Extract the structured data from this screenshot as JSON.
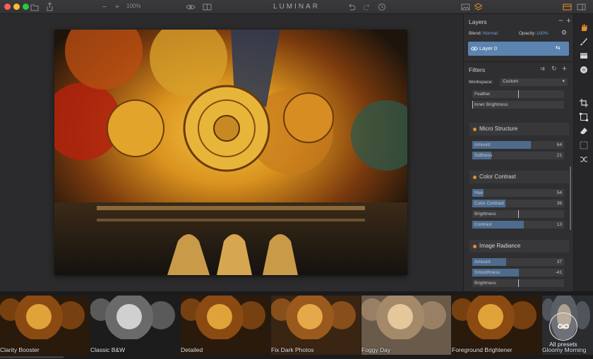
{
  "app": {
    "title": "LUMINAR",
    "zoom": "100%"
  },
  "colors": {
    "accent": "#5b84b0",
    "orange": "#e48d2a",
    "link": "#6fa3d9"
  },
  "layers": {
    "title": "Layers",
    "blend_label": "Blend:",
    "blend_value": "Normal",
    "opacity_label": "Opacity:",
    "opacity_value": "100%",
    "layer_name": "Layer 0"
  },
  "filters": {
    "title": "Filters",
    "workspace_label": "Workspace:",
    "workspace_value": "Custom",
    "top_sliders": [
      {
        "label": "Feather",
        "value": "",
        "level": 0.5
      },
      {
        "label": "Inner Brightness",
        "value": "",
        "level": 0.0
      }
    ],
    "groups": [
      {
        "name": "Micro Structure",
        "sliders": [
          {
            "label": "Amount",
            "value": "64",
            "level": 0.64
          },
          {
            "label": "Softness",
            "value": "21",
            "level": 0.21
          }
        ]
      },
      {
        "name": "Color Contrast",
        "sliders": [
          {
            "label": "Hue",
            "value": "54",
            "level": 0.12
          },
          {
            "label": "Color Contrast",
            "value": "36",
            "level": 0.36
          },
          {
            "label": "Brightness",
            "value": "",
            "level": 0.5
          },
          {
            "label": "Contrast",
            "value": "13",
            "level": 0.56
          }
        ]
      },
      {
        "name": "Image Radiance",
        "sliders": [
          {
            "label": "Amount",
            "value": "37",
            "level": 0.37
          },
          {
            "label": "Smoothness",
            "value": "-41",
            "level": 0.51
          },
          {
            "label": "Brightness",
            "value": "",
            "level": 0.5
          }
        ]
      }
    ]
  },
  "presets": [
    {
      "label": "Clarity Booster",
      "tone": "warm"
    },
    {
      "label": "Classic B&W",
      "tone": "bw"
    },
    {
      "label": "Detailed",
      "tone": "warm"
    },
    {
      "label": "Fix Dark Photos",
      "tone": "warm2"
    },
    {
      "label": "Foggy Day",
      "tone": "foggy"
    },
    {
      "label": "Foreground Brightener",
      "tone": "warm"
    },
    {
      "label": "Gloomy Morning",
      "tone": "cool"
    }
  ],
  "all_presets_label": "All presets",
  "icons": [
    "folder-icon",
    "share-icon",
    "eye-icon",
    "compare-icon",
    "undo-icon",
    "redo-icon",
    "history-icon",
    "image-icon",
    "layers-icon",
    "panel-icon"
  ]
}
